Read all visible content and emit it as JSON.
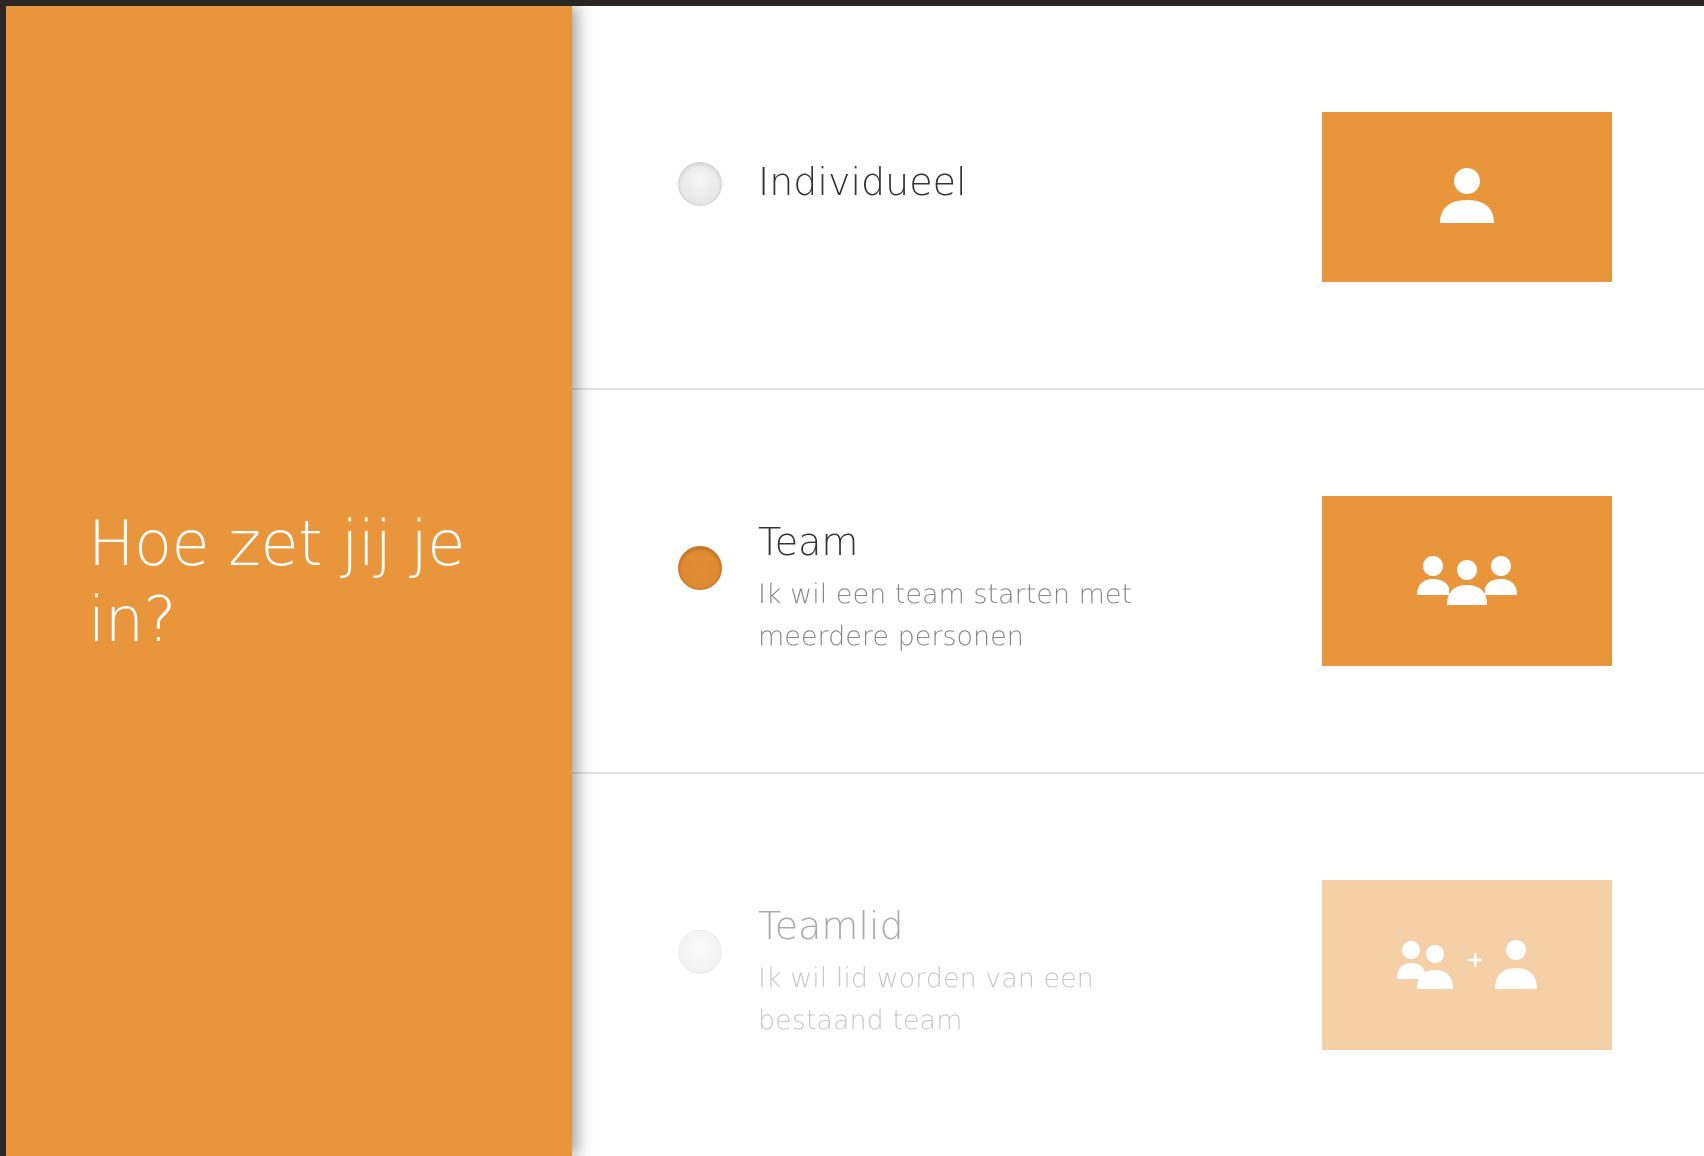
{
  "colors": {
    "accent": "#e8953b",
    "accent_faded": "#f5cfa5",
    "background": "#ffffff",
    "divider": "#e2e2e2"
  },
  "question": "Hoe zet jij je in?",
  "options": [
    {
      "title": "Individueel",
      "description": "",
      "selected": false,
      "disabled": false,
      "icon": "single-person-icon"
    },
    {
      "title": "Team",
      "description": "Ik wil een team starten met meerdere personen",
      "selected": true,
      "disabled": false,
      "icon": "group-icon"
    },
    {
      "title": "Teamlid",
      "description": "Ik wil lid worden van een bestaand team",
      "selected": false,
      "disabled": true,
      "icon": "group-add-person-icon"
    }
  ]
}
